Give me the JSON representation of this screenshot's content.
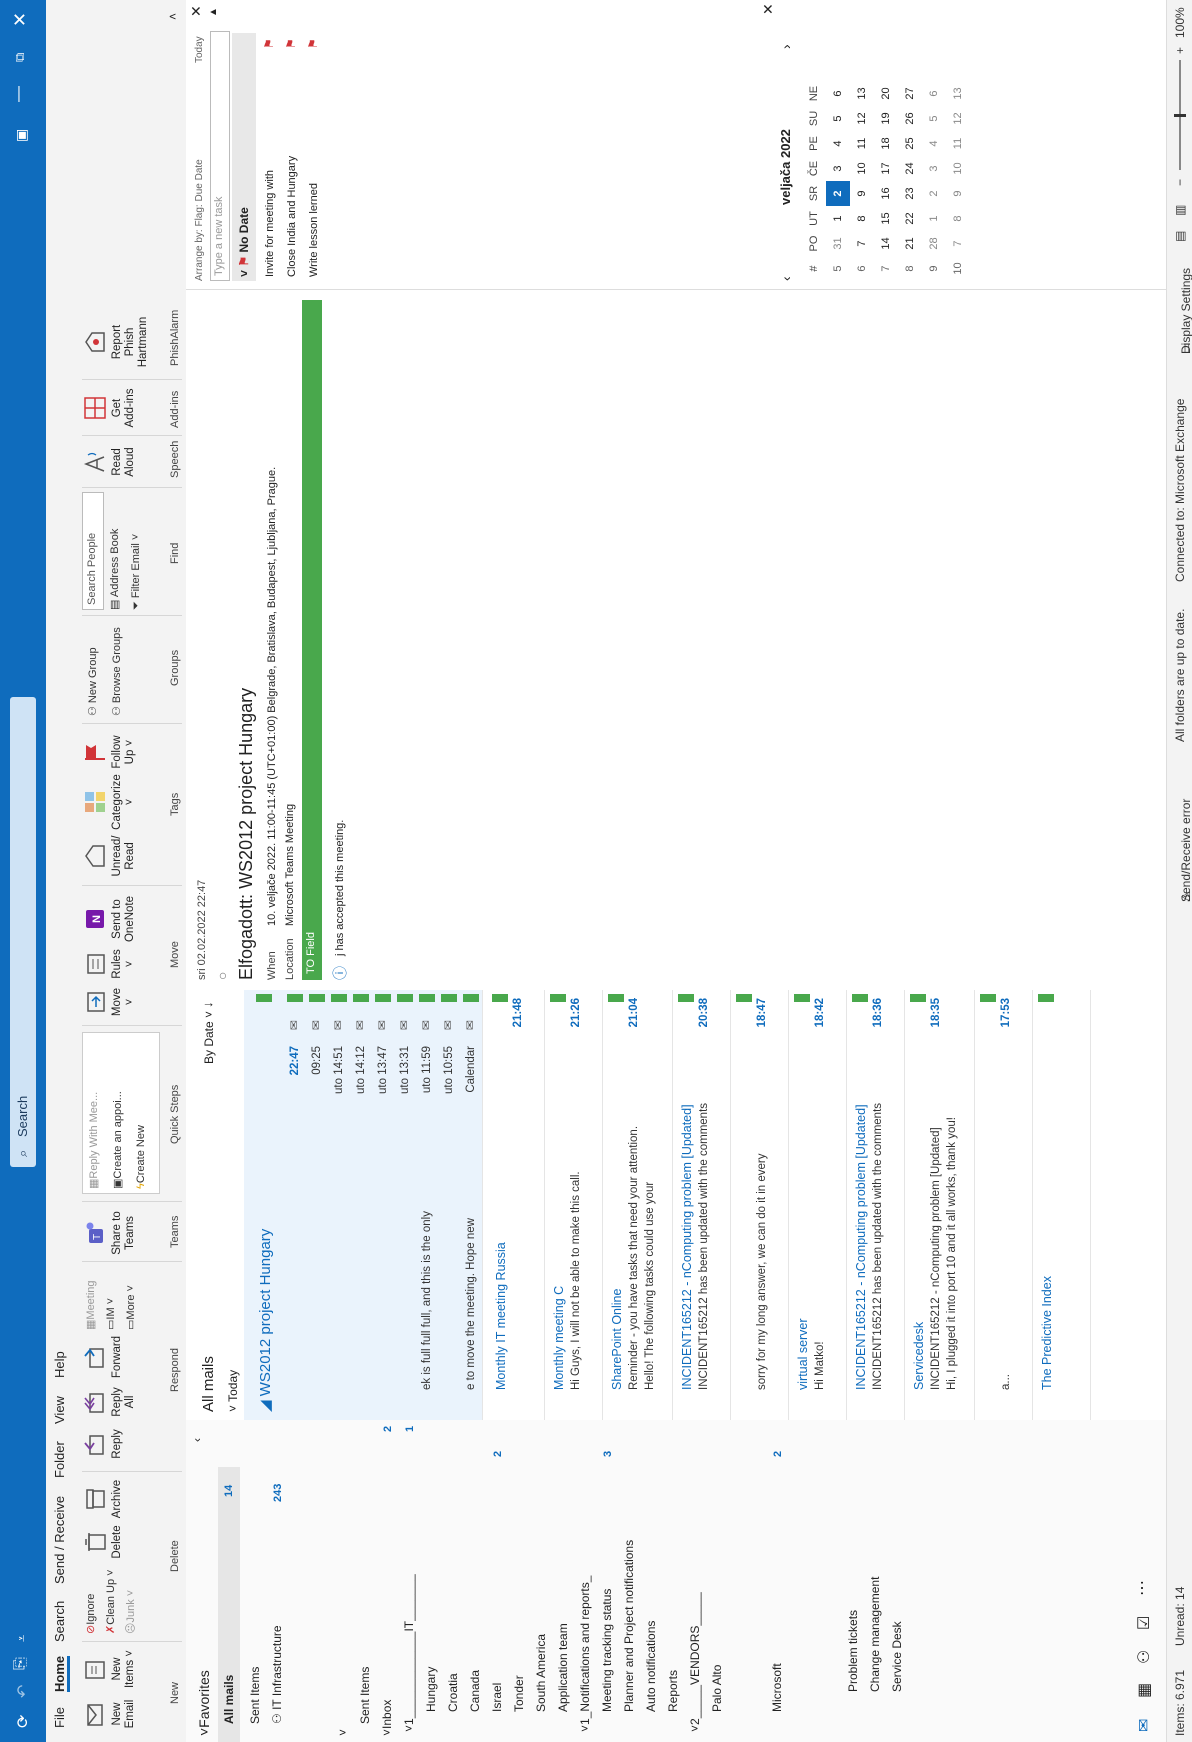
{
  "titlebar": {
    "search_placeholder": "Search"
  },
  "tabs": [
    "File",
    "Home",
    "Search",
    "Send / Receive",
    "Folder",
    "View",
    "Help"
  ],
  "ribbon": {
    "new": {
      "new_email": "New Email",
      "new_items": "New Items ˅",
      "group": "New"
    },
    "delete": {
      "ignore": "Ignore",
      "clean_up": "Clean Up ˅",
      "junk": "Junk ˅",
      "delete": "Delete",
      "archive": "Archive",
      "group": "Delete"
    },
    "respond": {
      "reply": "Reply",
      "reply_all": "Reply All",
      "forward": "Forward",
      "meeting": "Meeting",
      "im": "IM ˅",
      "more": "More ˅",
      "group": "Respond"
    },
    "teams": {
      "share": "Share to Teams",
      "group": "Teams"
    },
    "quicksteps": {
      "reply_with_meeting": "Reply With Mee...",
      "create_appointment": "Create an appoi...",
      "create_new": "Create New",
      "group": "Quick Steps"
    },
    "move": {
      "move": "Move ˅",
      "rules": "Rules ˅",
      "onenote": "Send to OneNote",
      "group": "Move"
    },
    "tags": {
      "unread_read": "Unread/ Read",
      "categorize": "Categorize ˅",
      "follow_up": "Follow Up ˅",
      "group": "Tags"
    },
    "groups": {
      "new_group": "New Group",
      "browse_groups": "Browse Groups",
      "group": "Groups"
    },
    "find": {
      "search_people": "Search People",
      "address_book": "Address Book",
      "filter_email": "Filter Email ˅",
      "group": "Find"
    },
    "speech": {
      "read_aloud": "Read Aloud",
      "group": "Speech"
    },
    "addins": {
      "get_addins": "Get Add-ins",
      "group": "Add-ins"
    },
    "phish": {
      "report": "Report Phish Hartmann",
      "group": "PhishAlarm"
    }
  },
  "folders": {
    "favorites_label": "Favorites",
    "favorites": [
      {
        "name": "All mails",
        "count": "14"
      },
      {
        "name": "Sent Items",
        "count": ""
      },
      {
        "name": "IT Infrastructure",
        "count": "243"
      }
    ],
    "tree": [
      {
        "name": "Sent Items",
        "count": ""
      },
      {
        "name": "Inbox",
        "count": "2"
      },
      {
        "name": "1_____________IT_______",
        "count": "1"
      },
      {
        "name": "Hungary",
        "count": ""
      },
      {
        "name": "Croatia",
        "count": ""
      },
      {
        "name": "Canada",
        "count": ""
      },
      {
        "name": "Israel",
        "count": "2"
      },
      {
        "name": "Tonder",
        "count": ""
      },
      {
        "name": "South America",
        "count": ""
      },
      {
        "name": "Application team",
        "count": ""
      },
      {
        "name": "1_Notifications and reports_",
        "count": ""
      },
      {
        "name": "Meeting tracking status",
        "count": "3"
      },
      {
        "name": "Planner and Project notifications",
        "count": ""
      },
      {
        "name": "Auto notifications",
        "count": ""
      },
      {
        "name": "Reports",
        "count": ""
      },
      {
        "name": "2_____VENDORS_____",
        "count": ""
      },
      {
        "name": "Palo Alto",
        "count": ""
      },
      {
        "name": "Microsoft",
        "count": "2"
      },
      {
        "name": "Problem tickets",
        "count": ""
      },
      {
        "name": "Change management",
        "count": ""
      },
      {
        "name": "Service Desk",
        "count": ""
      }
    ]
  },
  "maillist": {
    "header": "All mails",
    "sort": "By Date ˅",
    "group_today": "Today",
    "thread_title": "WS2012 project Hungary",
    "thread_rows": [
      {
        "text": "",
        "time": "22:47"
      },
      {
        "text": "",
        "time": "09:25"
      },
      {
        "text": "",
        "time": "uto 14:51"
      },
      {
        "text": "",
        "time": "uto 14:12"
      },
      {
        "text": "",
        "time": "uto 13:47"
      },
      {
        "text": "",
        "time": "uto 13:31"
      },
      {
        "text": "ek is full full full, and this is the only",
        "time": "uto 11:59"
      },
      {
        "text": "",
        "time": "uto 10:55"
      },
      {
        "text": "e to move the meeting. Hope new",
        "time": "Calendar"
      }
    ],
    "mails": [
      {
        "title": "Monthly IT meeting Russia",
        "line1": "",
        "time": "21:48"
      },
      {
        "title": "Monthly meeting C",
        "line1": "Hi Guys,   I will not be able to make this call.",
        "time": "21:26"
      },
      {
        "title": "SharePoint Online",
        "line1": "Reminder - you have tasks that need your attention.",
        "line2": "Hello! The following tasks could use your",
        "time": "21:04"
      },
      {
        "title": "INCIDENT165212 - nComputing problem [Updated]",
        "line1": "INCIDENT165212 has been updated with the comments",
        "time": "20:38"
      },
      {
        "title": "",
        "line1": "sorry for my long answer, we can do it in every",
        "time": "18:47"
      },
      {
        "title": "virtual server",
        "line1": "Hi Matko!",
        "time": "18:42"
      },
      {
        "title": "INCIDENT165212 - nComputing problem [Updated]",
        "line1": "INCIDENT165212 has been updated with the comments",
        "time": "18:36"
      },
      {
        "title": "Servicedesk",
        "line1": "INCIDENT165212 - nComputing problem [Updated]",
        "line2": "Hi,  I plugged it into port 10 and it all works, thank you!",
        "time": "18:35"
      },
      {
        "title": "",
        "line1": "a...",
        "time": "17:53"
      },
      {
        "title": "The Predictive Index",
        "line1": "",
        "time": ""
      }
    ]
  },
  "reading": {
    "date": "sri 02.02.2022 22:47",
    "subject": "Elfogadott: WS2012 project Hungary",
    "when_label": "When",
    "when_value": "10. veljače 2022. 11:00-11:45 (UTC+01:00) Belgrade, Bratislava, Budapest, Ljubljana, Prague.",
    "location_label": "Location",
    "location_value": "Microsoft Teams Meeting",
    "category": "TO Field",
    "accepted": "j has accepted this meeting."
  },
  "tasks": {
    "arrange": "Arrange by: Flag: Due Date",
    "today_link": "Today",
    "new_task_placeholder": "Type a new task",
    "group": "No Date",
    "items": [
      "Invite for meeting with",
      "Close India and Hungary",
      "Write lesson lerned"
    ]
  },
  "calendar": {
    "month": "veljača 2022",
    "headers": [
      "#",
      "PO",
      "UT",
      "SR",
      "ČE",
      "PE",
      "SU",
      "NE"
    ],
    "weeks": [
      [
        "5",
        "31",
        "1",
        "2",
        "3",
        "4",
        "5",
        "6"
      ],
      [
        "6",
        "7",
        "8",
        "9",
        "10",
        "11",
        "12",
        "13"
      ],
      [
        "7",
        "14",
        "15",
        "16",
        "17",
        "18",
        "19",
        "20"
      ],
      [
        "8",
        "21",
        "22",
        "23",
        "24",
        "25",
        "26",
        "27"
      ],
      [
        "9",
        "28",
        "1",
        "2",
        "3",
        "4",
        "5",
        "6"
      ],
      [
        "10",
        "7",
        "8",
        "9",
        "10",
        "11",
        "12",
        "13"
      ]
    ],
    "today": "2"
  },
  "statusbar": {
    "items": "Items: 6.971",
    "unread": "Unread: 14",
    "error": "Send/Receive error",
    "uptodate": "All folders are up to date.",
    "connected": "Connected to: Microsoft Exchange",
    "display": "Display Settings",
    "zoom": "100%"
  },
  "colors": {
    "accent": "#0f6cbd",
    "flag_green": "#49a84c",
    "flag_red": "#d13438"
  }
}
